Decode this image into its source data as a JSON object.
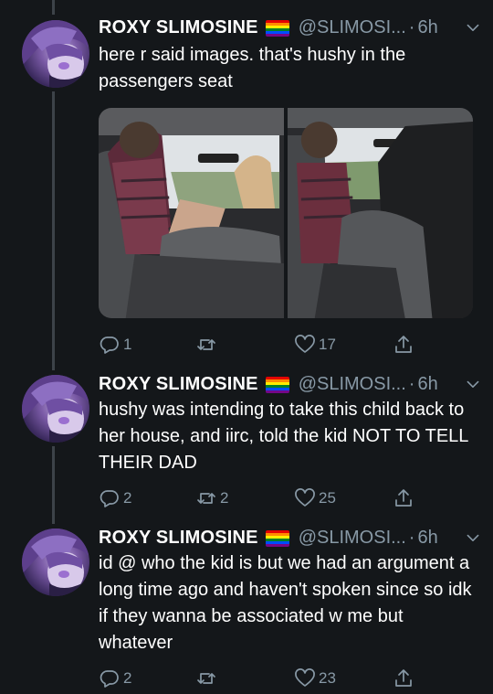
{
  "tweets": [
    {
      "name": "ROXY SLIMOSINE",
      "handle": "@SLIMOSI...",
      "time": "6h",
      "text": "here r said images. that's hushy in the passengers seat",
      "replies": "1",
      "retweets": "",
      "likes": "17",
      "has_media": true
    },
    {
      "name": "ROXY SLIMOSINE",
      "handle": "@SLIMOSI...",
      "time": "6h",
      "text": "hushy was intending to take this child back to her house, and iirc, told the kid NOT TO TELL THEIR DAD",
      "replies": "2",
      "retweets": "2",
      "likes": "25",
      "has_media": false
    },
    {
      "name": "ROXY SLIMOSINE",
      "handle": "@SLIMOSI...",
      "time": "6h",
      "text": "id @ who the kid is but we had an argument a long time ago and haven't spoken since so idk if they wanna be associated w me but whatever",
      "replies": "2",
      "retweets": "",
      "likes": "23",
      "has_media": false
    }
  ],
  "icons": {
    "reply": "reply-icon",
    "retweet": "retweet-icon",
    "like": "heart-icon",
    "share": "share-icon",
    "more": "chevron-down-icon",
    "flag": "rainbow-flag-icon"
  },
  "colors": {
    "background": "#14171a",
    "secondary_text": "#8899a6",
    "thread_line": "#3d4349"
  }
}
